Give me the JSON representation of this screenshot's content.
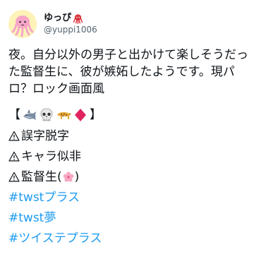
{
  "user": {
    "display_name": "ゆっぴ",
    "handle": "@yuppi1006"
  },
  "tweet": {
    "text": "夜。自分以外の男子と出かけて楽しそうだった監督生に、彼が嫉妬したようです。現パロ？ロック画面風",
    "bracket_open": "【",
    "bracket_close": "】",
    "emojis": [
      "shark-icon",
      "skull-icon",
      "leopard-icon",
      "red-diamond-icon"
    ],
    "warnings": [
      {
        "icon": "warning-icon",
        "text": "誤字脱字"
      },
      {
        "icon": "warning-icon",
        "text": "キャラ似非"
      },
      {
        "icon": "warning-icon",
        "text": "監督生(",
        "suffix": ")",
        "flower": "cherry-blossom-icon"
      }
    ],
    "hashtags": [
      "#twstプラス",
      "#twst夢",
      "#ツイステプラス"
    ]
  },
  "colors": {
    "link": "#1d9bf0",
    "text": "#0f1419",
    "secondary": "#536471",
    "avatar_bg": "#fdf3b8"
  }
}
